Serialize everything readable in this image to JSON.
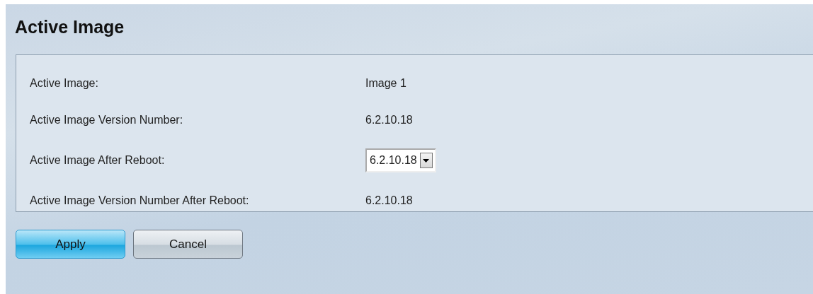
{
  "page": {
    "title": "Active Image"
  },
  "fields": [
    {
      "kind": "text",
      "label": "Active Image:",
      "value": "Image 1"
    },
    {
      "kind": "text",
      "label": "Active Image Version Number:",
      "value": "6.2.10.18"
    },
    {
      "kind": "select",
      "label": "Active Image After Reboot:",
      "value": "6.2.10.18"
    },
    {
      "kind": "text",
      "label": "Active Image Version Number After Reboot:",
      "value": "6.2.10.18"
    }
  ],
  "buttons": [
    {
      "kind": "primary",
      "label": "Apply"
    },
    {
      "kind": "secondary",
      "label": "Cancel"
    }
  ]
}
